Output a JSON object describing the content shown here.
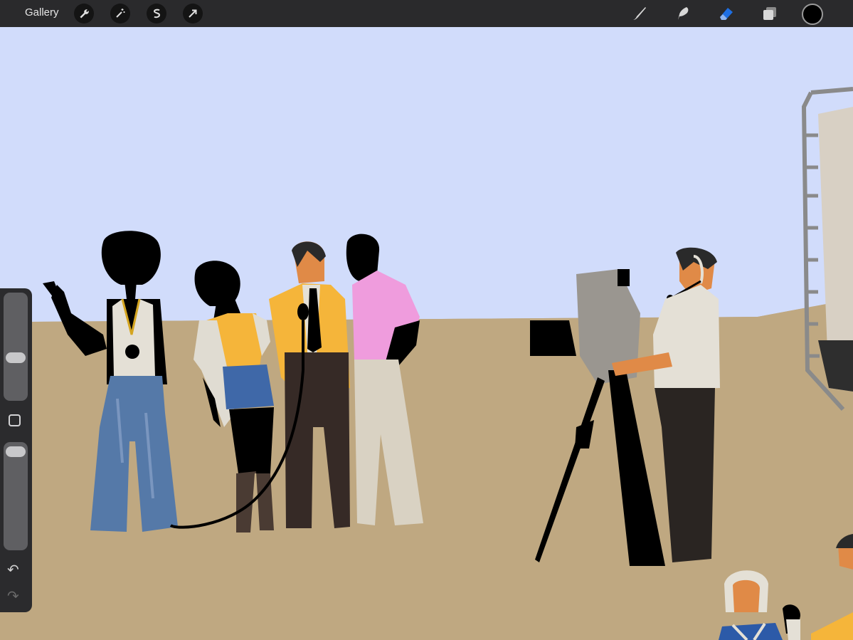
{
  "app": {
    "gallery_label": "Gallery"
  },
  "toolbar_left": [
    {
      "name": "actions",
      "icon": "wrench-icon"
    },
    {
      "name": "adjustments",
      "icon": "magic-wand-icon"
    },
    {
      "name": "selection",
      "icon": "selection-s-icon"
    },
    {
      "name": "transform",
      "icon": "arrow-cursor-icon"
    }
  ],
  "toolbar_right": [
    {
      "name": "brush",
      "icon": "brush-icon"
    },
    {
      "name": "smudge",
      "icon": "smudge-icon"
    },
    {
      "name": "eraser",
      "icon": "eraser-icon",
      "active": true
    },
    {
      "name": "layers",
      "icon": "layers-icon"
    }
  ],
  "current_color": "#000000",
  "accent_color": "#1e6fe3",
  "brush_size_level": 0.21,
  "brush_opacity_level": 0.93,
  "canvas": {
    "sky_color": "#d1dcfb",
    "ground_color": "#bfa881",
    "description_icons": [
      "figure-icon",
      "camera-icon",
      "microphone-icon"
    ]
  }
}
